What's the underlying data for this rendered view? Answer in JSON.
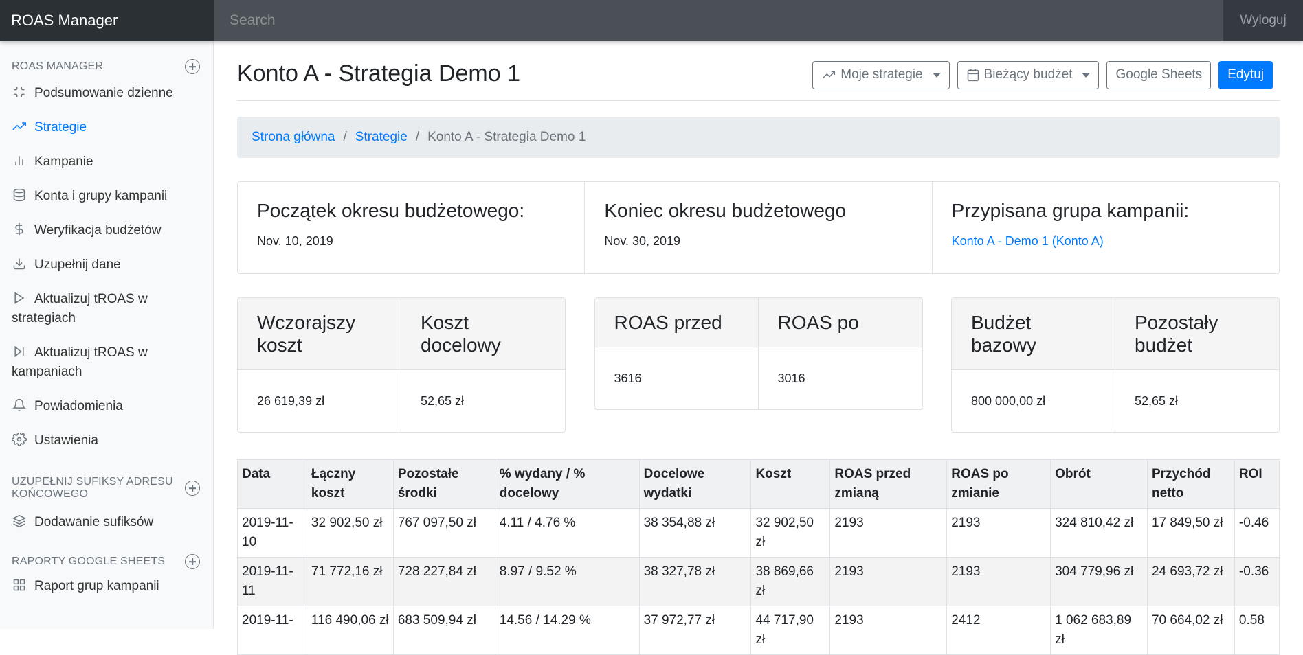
{
  "navbar": {
    "brand": "ROAS Manager",
    "search_placeholder": "Search",
    "signout": "Wyloguj"
  },
  "sidebar": {
    "sections": [
      {
        "heading": "ROAS MANAGER"
      },
      {
        "heading": "UZUPEŁNIJ SUFIKSY ADRESU KOŃCOWEGO"
      },
      {
        "heading": "RAPORTY GOOGLE SHEETS"
      }
    ],
    "items": [
      {
        "label": "Podsumowanie dzienne",
        "icon": "minimize-icon"
      },
      {
        "label": "Strategie",
        "icon": "trending-up-icon"
      },
      {
        "label": "Kampanie",
        "icon": "bar-chart-icon"
      },
      {
        "label": "Konta i grupy kampanii",
        "icon": "database-icon"
      },
      {
        "label": "Weryfikacja budżetów",
        "icon": "dollar-icon"
      },
      {
        "label": "Uzupełnij dane",
        "icon": "download-icon"
      },
      {
        "label": "Aktualizuj tROAS w strategiach",
        "icon": "play-icon"
      },
      {
        "label": "Aktualizuj tROAS w kampaniach",
        "icon": "skip-forward-icon"
      },
      {
        "label": "Powiadomienia",
        "icon": "bell-icon"
      },
      {
        "label": "Ustawienia",
        "icon": "settings-icon"
      },
      {
        "label": "Dodawanie sufiksów",
        "icon": "layers-icon"
      },
      {
        "label": "Raport grup kampanii",
        "icon": "grid-icon"
      }
    ]
  },
  "header": {
    "title": "Konto A - Strategia Demo 1",
    "buttons": {
      "strategies": "Moje strategie",
      "budget": "Bieżący budżet",
      "sheets": "Google Sheets",
      "edit": "Edytuj"
    }
  },
  "breadcrumb": {
    "home": "Strona główna",
    "strategies": "Strategie",
    "current": "Konto A - Strategia Demo 1"
  },
  "info": {
    "start_label": "Początek okresu budżetowego:",
    "start_value": "Nov. 10, 2019",
    "end_label": "Koniec okresu budżetowego",
    "end_value": "Nov. 30, 2019",
    "group_label": "Przypisana grupa kampanii:",
    "group_value": "Konto A - Demo 1 (Konto A)"
  },
  "metrics": {
    "yesterday_cost_label": "Wczorajszy koszt",
    "yesterday_cost": "26 619,39 zł",
    "target_cost_label": "Koszt docelowy",
    "target_cost": "52,65 zł",
    "roas_before_label": "ROAS przed",
    "roas_before": "3616",
    "roas_after_label": "ROAS po",
    "roas_after": "3016",
    "base_budget_label": "Budżet bazowy",
    "base_budget": "800 000,00 zł",
    "remaining_budget_label": "Pozostały budżet",
    "remaining_budget": "52,65 zł"
  },
  "table": {
    "headers": [
      "Data",
      "Łączny koszt",
      "Pozostałe środki",
      "% wydany / % docelowy",
      "Docelowe wydatki",
      "Koszt",
      "ROAS przed zmianą",
      "ROAS po zmianie",
      "Obrót",
      "Przychód netto",
      "ROI"
    ],
    "rows": [
      [
        "2019-11-10",
        "32 902,50 zł",
        "767 097,50 zł",
        "4.11 / 4.76 %",
        "38 354,88 zł",
        "32 902,50 zł",
        "2193",
        "2193",
        "324 810,42 zł",
        "17 849,50 zł",
        "-0.46"
      ],
      [
        "2019-11-11",
        "71 772,16 zł",
        "728 227,84 zł",
        "8.97 / 9.52 %",
        "38 327,78 zł",
        "38 869,66 zł",
        "2193",
        "2193",
        "304 779,96 zł",
        "24 693,72 zł",
        "-0.36"
      ],
      [
        "2019-11-",
        "116 490,06 zł",
        "683 509,94 zł",
        "14.56 / 14.29 %",
        "37 972,77 zł",
        "44 717,90 zł",
        "2193",
        "2412",
        "1 062 683,89 zł",
        "70 664,02 zł",
        "0.58"
      ]
    ]
  }
}
